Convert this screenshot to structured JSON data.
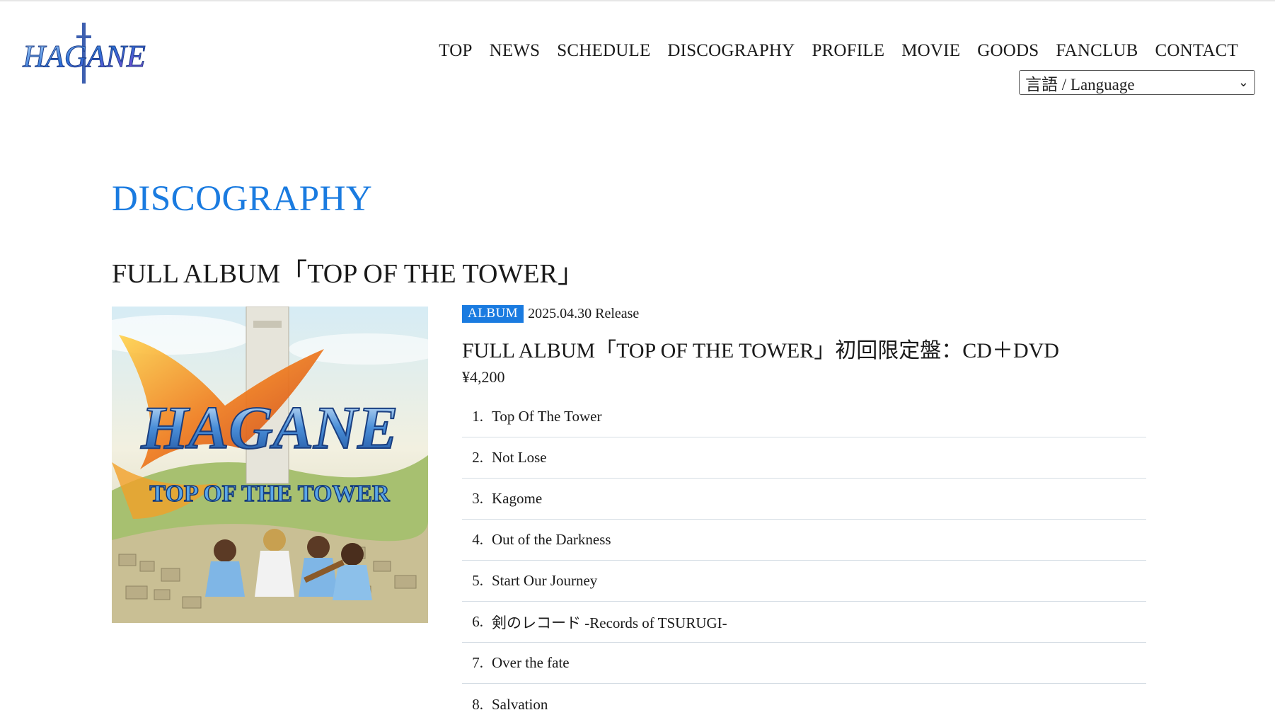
{
  "brand": {
    "logo_text": "HAGANE",
    "logo_icon": "sword-logo-icon"
  },
  "nav": {
    "items": [
      {
        "label": "TOP"
      },
      {
        "label": "NEWS"
      },
      {
        "label": "SCHEDULE"
      },
      {
        "label": "DISCOGRAPHY"
      },
      {
        "label": "PROFILE"
      },
      {
        "label": "MOVIE"
      },
      {
        "label": "GOODS"
      },
      {
        "label": "FANCLUB"
      },
      {
        "label": "CONTACT"
      }
    ],
    "language_select": {
      "value": "言語 / Language",
      "icon": "chevron-down-icon"
    }
  },
  "page": {
    "title": "DISCOGRAPHY",
    "album_heading": "FULL ALBUM「TOP OF THE TOWER」"
  },
  "release": {
    "badge": "ALBUM",
    "date": "2025.04.30 Release",
    "edition_title": "FULL ALBUM「TOP OF THE TOWER」初回限定盤：CD＋DVD",
    "price": "¥4,200",
    "cover": {
      "logo_text": "HAGANE",
      "subtitle_text": "TOP OF THE TOWER"
    },
    "tracks": [
      {
        "no": "1.",
        "title": "Top Of The Tower"
      },
      {
        "no": "2.",
        "title": "Not Lose"
      },
      {
        "no": "3.",
        "title": "Kagome"
      },
      {
        "no": "4.",
        "title": "Out of the Darkness"
      },
      {
        "no": "5.",
        "title": "Start Our Journey"
      },
      {
        "no": "6.",
        "title": "剣のレコード -Records of TSURUGI-"
      },
      {
        "no": "7.",
        "title": "Over the fate"
      },
      {
        "no": "8.",
        "title": "Salvation"
      }
    ]
  },
  "colors": {
    "accent": "#1a7be0",
    "text": "#1a1a1a",
    "divider": "#d5dde4"
  }
}
